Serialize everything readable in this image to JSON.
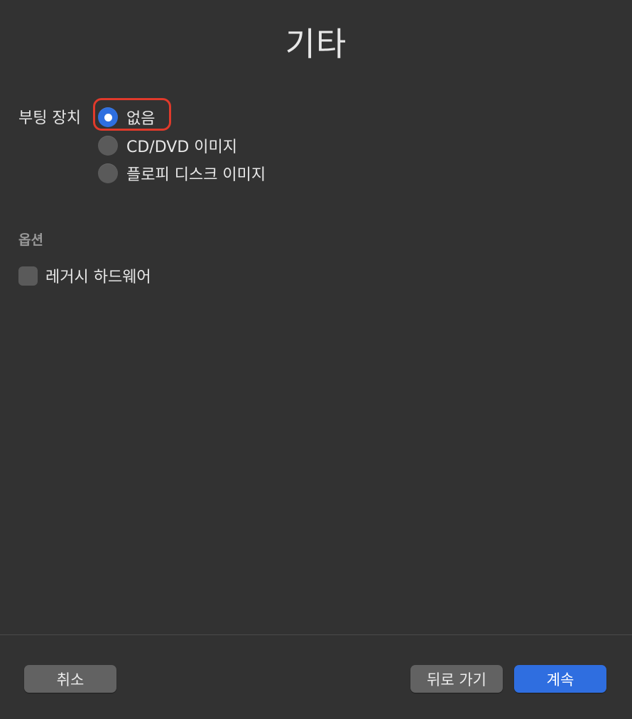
{
  "dialog": {
    "title": "기타"
  },
  "boot_device": {
    "label": "부팅 장치",
    "options": [
      {
        "label": "없음",
        "selected": true
      },
      {
        "label": "CD/DVD 이미지",
        "selected": false
      },
      {
        "label": "플로피 디스크 이미지",
        "selected": false
      }
    ]
  },
  "options_section": {
    "title": "옵션",
    "legacy_hardware": {
      "label": "레거시 하드웨어",
      "checked": false
    }
  },
  "footer": {
    "cancel_label": "취소",
    "back_label": "뒤로 가기",
    "continue_label": "계속"
  },
  "colors": {
    "background": "#323232",
    "accent": "#2f6ee0",
    "highlight": "#e03a2b"
  }
}
